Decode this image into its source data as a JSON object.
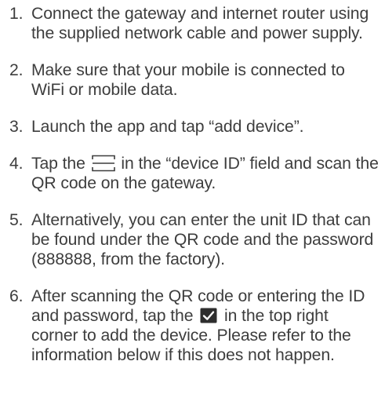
{
  "steps": [
    {
      "number": "1.",
      "text": "Connect the gateway and internet router using the supplied network cable and power supply."
    },
    {
      "number": "2.",
      "text": "Make sure that your mobile is connected to WiFi or mobile data."
    },
    {
      "number": "3.",
      "text": "Launch the app and tap “add device”."
    },
    {
      "number": "4.",
      "text_before_icon": "Tap the ",
      "icon": "qr-scan-frame-icon",
      "text_after_icon": " in the “device ID” field and scan the QR code on the gateway."
    },
    {
      "number": "5.",
      "text": "Alternatively, you can enter the unit ID that can be found under the QR code and the password (888888, from the factory)."
    },
    {
      "number": "6.",
      "text_before_icon": "After scanning the QR code or entering the ID and password, tap the ",
      "icon": "checkmark-icon",
      "text_after_icon": " in the top right corner to add the device.  Please refer to the information below if this does not happen."
    }
  ],
  "colors": {
    "text": "#3d3d3d",
    "icon_stroke": "#3d3d3d",
    "check_background": "#2e2e2e",
    "check_mark": "#ffffff"
  }
}
